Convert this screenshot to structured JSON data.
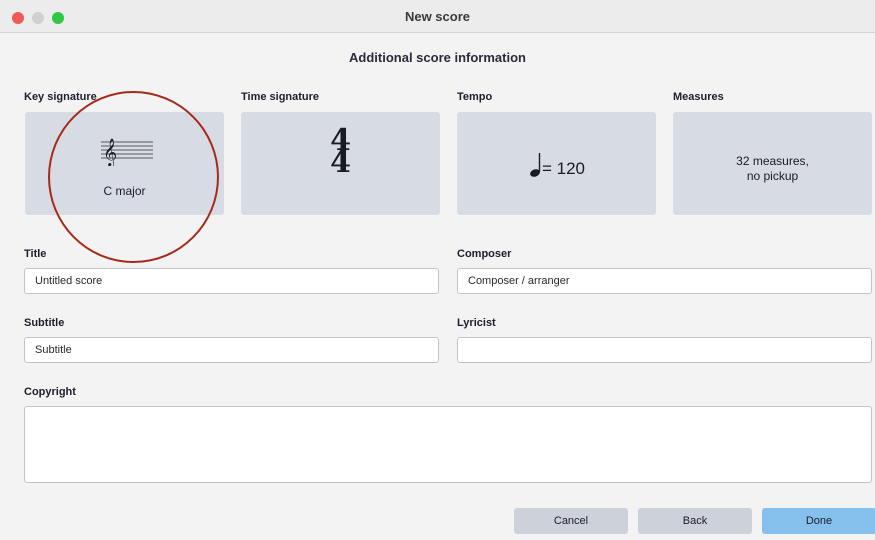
{
  "window": {
    "title": "New score"
  },
  "heading": "Additional score information",
  "cards": {
    "key_signature": {
      "label": "Key signature",
      "value": "C major",
      "icon": "treble-clef-staff-icon"
    },
    "time_signature": {
      "label": "Time signature",
      "numerator": "4",
      "denominator": "4"
    },
    "tempo": {
      "label": "Tempo",
      "note_icon": "quarter-note-icon",
      "value": "= 120"
    },
    "measures": {
      "label": "Measures",
      "line1": "32 measures,",
      "line2": "no pickup"
    }
  },
  "fields": {
    "title": {
      "label": "Title",
      "value": "Untitled score"
    },
    "composer": {
      "label": "Composer",
      "value": "Composer / arranger"
    },
    "subtitle": {
      "label": "Subtitle",
      "value": "Subtitle"
    },
    "lyricist": {
      "label": "Lyricist",
      "value": ""
    },
    "copyright": {
      "label": "Copyright",
      "value": ""
    }
  },
  "buttons": {
    "cancel": "Cancel",
    "back": "Back",
    "done": "Done"
  },
  "colors": {
    "card_bg": "#d7dbe3",
    "primary_button": "#86c0ec",
    "secondary_button": "#ccd1da",
    "annotation_circle": "#a52a1a"
  }
}
